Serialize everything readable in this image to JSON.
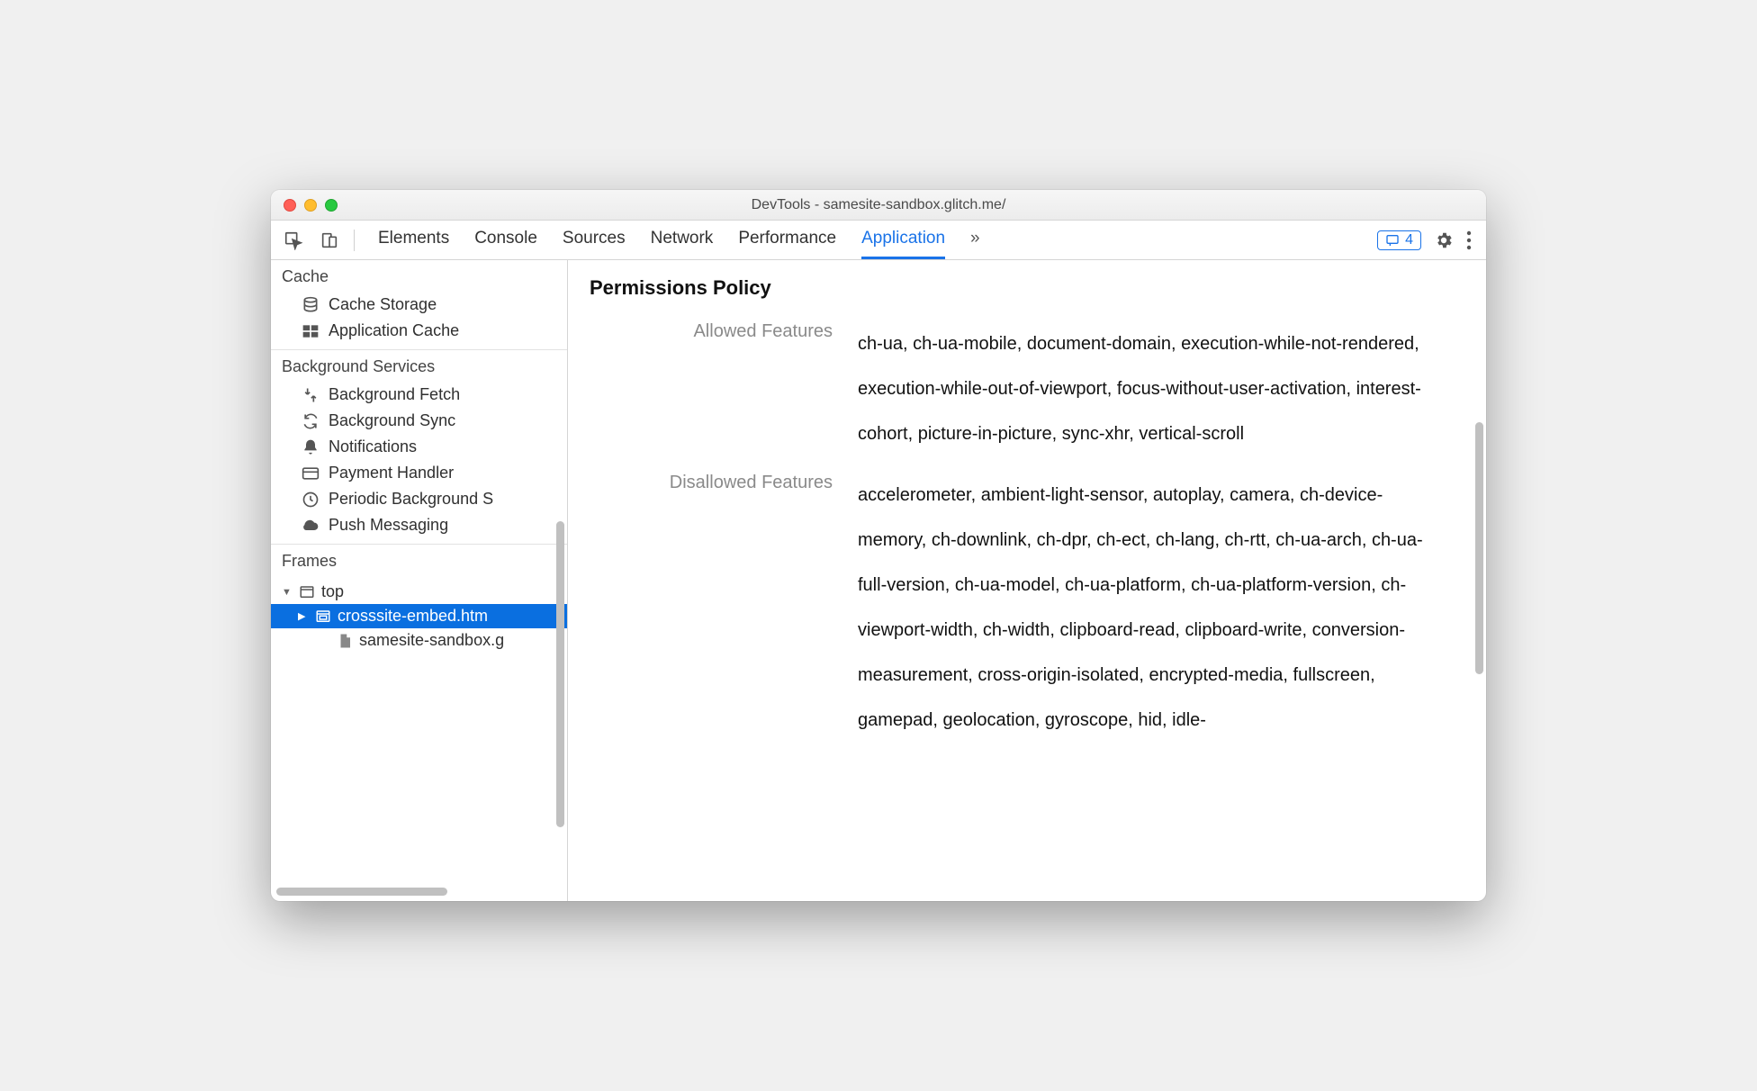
{
  "window": {
    "title": "DevTools - samesite-sandbox.glitch.me/"
  },
  "tabs": {
    "items": [
      {
        "label": "Elements"
      },
      {
        "label": "Console"
      },
      {
        "label": "Sources"
      },
      {
        "label": "Network"
      },
      {
        "label": "Performance"
      },
      {
        "label": "Application"
      }
    ],
    "active": 5,
    "more": "»",
    "messageCount": "4"
  },
  "sidebar": {
    "cache": {
      "title": "Cache",
      "items": [
        {
          "label": "Cache Storage",
          "icon": "database-icon"
        },
        {
          "label": "Application Cache",
          "icon": "grid-icon"
        }
      ]
    },
    "bg": {
      "title": "Background Services",
      "items": [
        {
          "label": "Background Fetch",
          "icon": "fetch-icon"
        },
        {
          "label": "Background Sync",
          "icon": "sync-icon"
        },
        {
          "label": "Notifications",
          "icon": "bell-icon"
        },
        {
          "label": "Payment Handler",
          "icon": "card-icon"
        },
        {
          "label": "Periodic Background S",
          "icon": "clock-icon"
        },
        {
          "label": "Push Messaging",
          "icon": "cloud-icon"
        }
      ]
    },
    "frames": {
      "title": "Frames",
      "top": {
        "label": "top",
        "icon": "window-icon"
      },
      "child": {
        "label": "crosssite-embed.htm",
        "icon": "frame-icon"
      },
      "doc": {
        "label": "samesite-sandbox.g",
        "icon": "file-icon"
      }
    }
  },
  "main": {
    "heading": "Permissions Policy",
    "rows": [
      {
        "label": "Allowed Features",
        "value": "ch-ua, ch-ua-mobile, document-domain, execution-while-not-rendered, execution-while-out-of-viewport, focus-without-user-activation, interest-cohort, picture-in-picture, sync-xhr, vertical-scroll"
      },
      {
        "label": "Disallowed Features",
        "value": "accelerometer, ambient-light-sensor, autoplay, camera, ch-device-memory, ch-downlink, ch-dpr, ch-ect, ch-lang, ch-rtt, ch-ua-arch, ch-ua-full-version, ch-ua-model, ch-ua-platform, ch-ua-platform-version, ch-viewport-width, ch-width, clipboard-read, clipboard-write, conversion-measurement, cross-origin-isolated, encrypted-media, fullscreen, gamepad, geolocation, gyroscope, hid, idle-"
      }
    ]
  }
}
